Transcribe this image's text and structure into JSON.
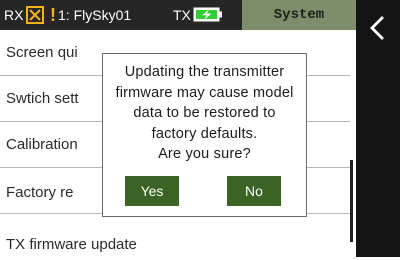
{
  "status_bar": {
    "rx_label": "RX",
    "rx_icon": "x-box-icon",
    "warning_icon": "warning-icon",
    "model_name": "1: FlySky01",
    "tx_label": "TX",
    "battery_icon": "battery-charging-icon",
    "battery_color": "#33cc33",
    "active_tab": "System",
    "tab_color": "#7f8e6a"
  },
  "nav": {
    "back_icon": "chevron-left-icon"
  },
  "menu": {
    "items": [
      {
        "label": "Screen qui"
      },
      {
        "label": "Swtich sett"
      },
      {
        "label": "Calibration"
      },
      {
        "label": "Factory re"
      },
      {
        "label": "TX firmware update"
      }
    ]
  },
  "dialog": {
    "lines": [
      "Updating the transmitter",
      "firmware may cause model",
      "data to be restored to",
      "factory defaults.",
      "Are you sure?"
    ],
    "yes_label": "Yes",
    "no_label": "No",
    "button_color": "#3b6323"
  }
}
